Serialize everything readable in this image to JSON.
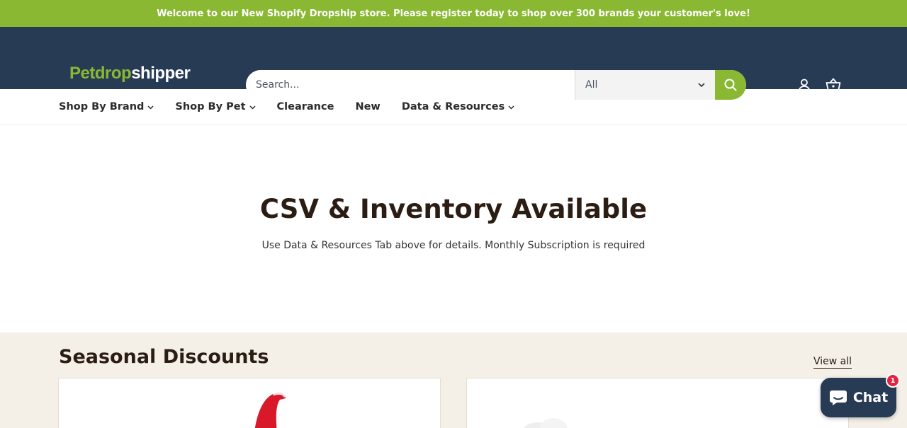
{
  "announcement": {
    "text": "Welcome to our New Shopify Dropship store. Please register today to shop over 300 brands your customer's love!"
  },
  "header": {
    "logo": {
      "part1": "Pet",
      "part2": "drop",
      "part3": "shipper"
    },
    "search": {
      "placeholder": "Search...",
      "category_selected": "All"
    },
    "icons": [
      "search-icon",
      "account-icon",
      "cart-icon"
    ]
  },
  "nav": {
    "items": [
      {
        "label": "Shop By Brand",
        "has_dropdown": true
      },
      {
        "label": "Shop By Pet",
        "has_dropdown": true
      },
      {
        "label": "Clearance",
        "has_dropdown": false
      },
      {
        "label": "New",
        "has_dropdown": false
      },
      {
        "label": "Data & Resources",
        "has_dropdown": true
      }
    ]
  },
  "hero": {
    "title": "CSV & Inventory Available",
    "subtitle": "Use Data & Resources Tab above for details. Monthly Subscription is required"
  },
  "seasonal": {
    "title": "Seasonal Discounts",
    "view_all": "View all"
  },
  "chat": {
    "label": "Chat",
    "badge": "1"
  },
  "colors": {
    "accent": "#8ab832",
    "header_bg": "#283b55",
    "heading": "#2b1d14",
    "section_bg": "#f4f0e8",
    "badge": "#e3233f"
  }
}
